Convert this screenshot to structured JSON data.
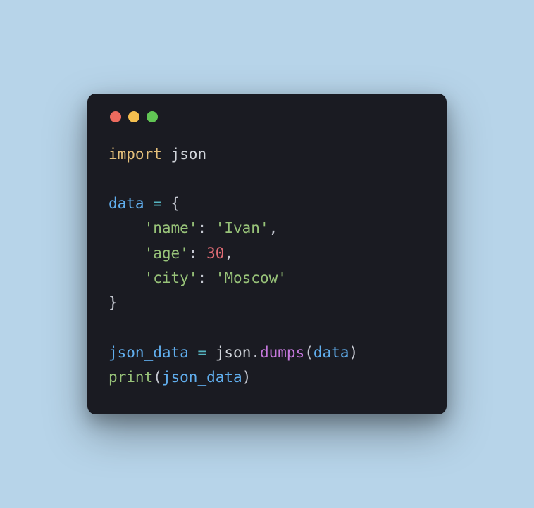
{
  "code": {
    "line1": {
      "import": "import",
      "module": "json"
    },
    "line3": {
      "var": "data",
      "eq": "=",
      "brace": "{"
    },
    "line4": {
      "indent": "    ",
      "key": "'name'",
      "colon": ": ",
      "value": "'Ivan'",
      "comma": ","
    },
    "line5": {
      "indent": "    ",
      "key": "'age'",
      "colon": ": ",
      "value": "30",
      "comma": ","
    },
    "line6": {
      "indent": "    ",
      "key": "'city'",
      "colon": ": ",
      "value": "'Moscow'"
    },
    "line7": {
      "brace": "}"
    },
    "line9": {
      "var": "json_data",
      "eq": "=",
      "obj": "json",
      "dot": ".",
      "method": "dumps",
      "lparen": "(",
      "arg": "data",
      "rparen": ")"
    },
    "line10": {
      "func": "print",
      "lparen": "(",
      "arg": "json_data",
      "rparen": ")"
    }
  }
}
